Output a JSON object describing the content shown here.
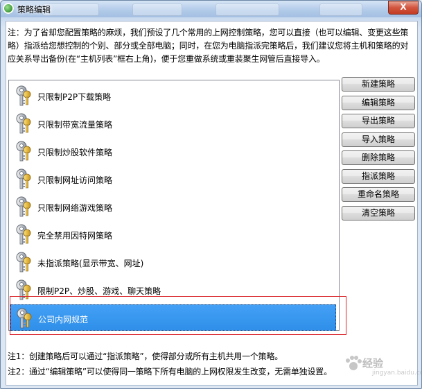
{
  "window": {
    "title": "策略编辑",
    "close_label": "X"
  },
  "notes": {
    "top": "注：为了省却您配置策略的麻烦，我们预设了几个常用的上网控制策略，您可以直接（也可以编辑、变更这些策\n略）指派给您想控制的个别、部分或全部电脑；同时，在您为电脑指派完策略后，我们建议您将主机和策略的对\n应关系导出备份(在“主机列表”框右上角)，便于您重做系统或重装聚生网管后直接导入。",
    "bottom1": "注1：创建策略后可以通过“指派策略”，使得部分或所有主机共用一个策略。",
    "bottom2": "注2：通过“编辑策略”可以使得同一策略下所有电脑的上网权限发生改变，无需单独设置。"
  },
  "policies": [
    {
      "label": "只限制P2P下载策略",
      "icon": "key-icon"
    },
    {
      "label": "只限制带宽流量策略",
      "icon": "key-icon"
    },
    {
      "label": "只限制炒股软件策略",
      "icon": "key-icon"
    },
    {
      "label": "只限制网址访问策略",
      "icon": "key-icon"
    },
    {
      "label": "只限制网络游戏策略",
      "icon": "key-icon"
    },
    {
      "label": "完全禁用因特网策略",
      "icon": "key-icon"
    },
    {
      "label": "未指派策略(显示带宽、网址)",
      "icon": "key-icon"
    },
    {
      "label": "限制P2P、炒股、游戏、聊天策略",
      "icon": "key-icon"
    },
    {
      "label": "公司内网规范",
      "icon": "key-icon",
      "selected": true
    }
  ],
  "buttons": {
    "new": "新建策略",
    "edit": "编辑策略",
    "export": "导出策略",
    "import": "导入策略",
    "delete": "删除策略",
    "assign": "指派策略",
    "rename": "重命名策略",
    "clear": "清空策略"
  },
  "watermark": {
    "text": "经验",
    "sub": "jingyan.baidu.com"
  },
  "colors": {
    "selection": "#3396ec",
    "highlight_border": "#d9262c",
    "title_bar": "#b0c9e8"
  }
}
